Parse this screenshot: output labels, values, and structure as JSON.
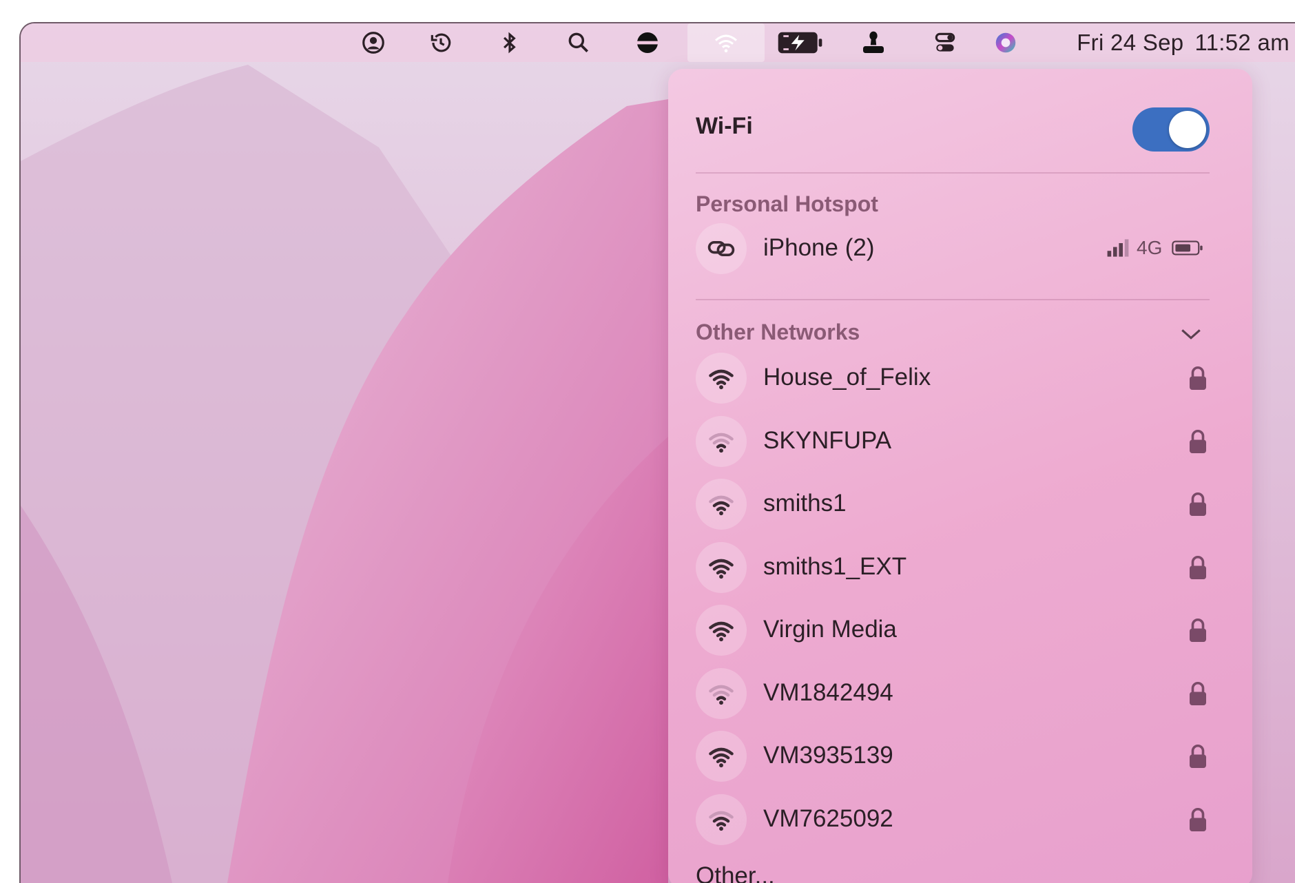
{
  "menubar": {
    "icons": [
      "user-circle-icon",
      "time-machine-icon",
      "bluetooth-icon",
      "search-icon",
      "vpn-icon",
      "wifi-icon",
      "battery-charging-icon",
      "stamp-icon",
      "control-center-icon",
      "siri-icon"
    ],
    "date": "Fri 24 Sep",
    "time": "11:52 am"
  },
  "wifi_panel": {
    "title": "Wi-Fi",
    "enabled": true,
    "toggle_color": "#3c6fc1",
    "hotspot_section": "Personal Hotspot",
    "hotspot": {
      "name": "iPhone (2)",
      "network": "4G",
      "icon": "link-icon"
    },
    "other_section": "Other Networks",
    "networks": [
      {
        "name": "House_of_Felix",
        "strength": 3,
        "secured": true
      },
      {
        "name": "SKYNFUPA",
        "strength": 1,
        "secured": true
      },
      {
        "name": "smiths1",
        "strength": 2,
        "secured": true
      },
      {
        "name": "smiths1_EXT",
        "strength": 3,
        "secured": true
      },
      {
        "name": "Virgin Media",
        "strength": 3,
        "secured": true
      },
      {
        "name": "VM1842494",
        "strength": 1,
        "secured": true
      },
      {
        "name": "VM3935139",
        "strength": 3,
        "secured": true
      },
      {
        "name": "VM7625092",
        "strength": 2,
        "secured": true
      }
    ],
    "other_label": "Other..."
  }
}
